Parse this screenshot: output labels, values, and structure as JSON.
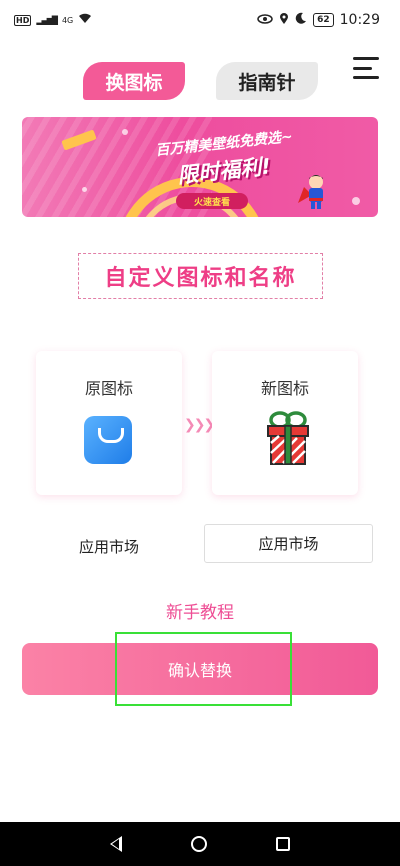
{
  "status_bar": {
    "hd": "HD",
    "network": "4G",
    "battery": "62",
    "time": "10:29"
  },
  "tabs": [
    {
      "label": "换图标",
      "active": true
    },
    {
      "label": "指南针",
      "active": false
    }
  ],
  "banner": {
    "line1": "百万精美壁纸免费选~",
    "line2": "限时福利!",
    "button": "火速查看"
  },
  "custom_title": "自定义图标和名称",
  "original": {
    "label": "原图标",
    "icon": "app-store-bag-icon",
    "name": "应用市场"
  },
  "new": {
    "label": "新图标",
    "icon": "gift-box-icon",
    "name": "应用市场"
  },
  "tutorial": "新手教程",
  "confirm_button": "确认替换",
  "colors": {
    "accent": "#f35a97",
    "accent_light": "#fb82a6",
    "highlight": "#39e037"
  }
}
